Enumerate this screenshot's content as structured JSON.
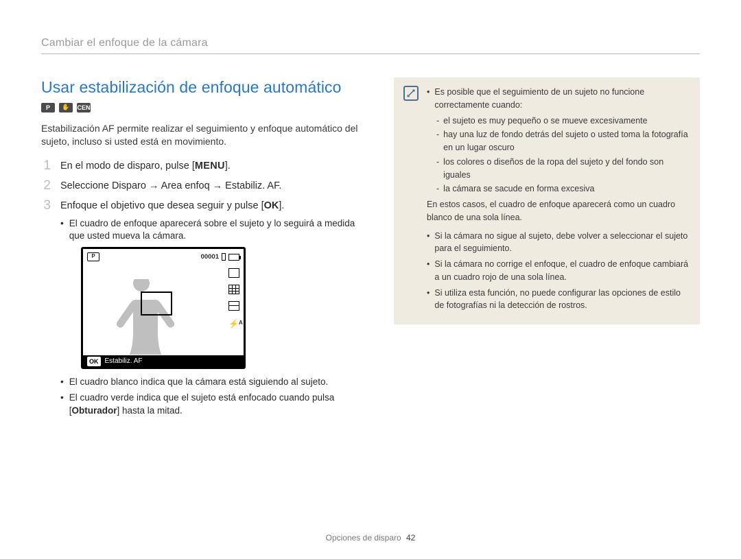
{
  "breadcrumb": "Cambiar el enfoque de la cámara",
  "section_title": "Usar estabilización de enfoque automático",
  "mode_icons": {
    "cam": "P",
    "hand": "✋",
    "scene": "SCENE"
  },
  "intro": "Estabilización AF permite realizar el seguimiento y enfoque automático del sujeto, incluso si usted está en movimiento.",
  "steps": {
    "s1": {
      "num": "1",
      "text_a": "En el modo de disparo, pulse [",
      "key": "MENU",
      "text_b": "]."
    },
    "s2": {
      "num": "2",
      "text": "Seleccione Disparo → Area enfoq → Estabiliz. AF."
    },
    "s3": {
      "num": "3",
      "text_a": "Enfoque el objetivo que desea seguir y pulse [",
      "key": "OK",
      "text_b": "].",
      "bullets": {
        "b1": "El cuadro de enfoque aparecerá sobre el sujeto y lo seguirá a medida que usted mueva la cámara.",
        "b2": "El cuadro blanco indica que la cámara está siguiendo al sujeto.",
        "b3_a": "El cuadro verde indica que el sujeto está enfocado cuando pulsa [",
        "b3_bold": "Obturador",
        "b3_b": "] hasta la mitad."
      }
    }
  },
  "camera_screen": {
    "counter": "00001",
    "ok_label": "OK",
    "bottom_label": "Estabiliz. AF"
  },
  "note": {
    "items": {
      "n1": "Es posible que el seguimiento de un sujeto no funcione correctamente cuando:",
      "dashes": {
        "d1": "el sujeto es muy pequeño o se mueve excesivamente",
        "d2": "hay una luz de fondo detrás del sujeto o usted toma la fotografía en un lugar oscuro",
        "d3": "los colores o diseños de la ropa del sujeto y del fondo son iguales",
        "d4": "la cámara se sacude en forma excesiva"
      },
      "after_dash": "En estos casos, el cuadro de enfoque aparecerá como un cuadro blanco de una sola línea.",
      "n2": "Si la cámara no sigue al sujeto, debe volver a seleccionar el sujeto para el seguimiento.",
      "n3": "Si la cámara no corrige el enfoque, el cuadro de enfoque cambiará a un cuadro rojo de una sola línea.",
      "n4": "Si utiliza esta función, no puede configurar las opciones de estilo de fotografías ni la detección de rostros."
    }
  },
  "footer": {
    "section": "Opciones de disparo",
    "page": "42"
  }
}
